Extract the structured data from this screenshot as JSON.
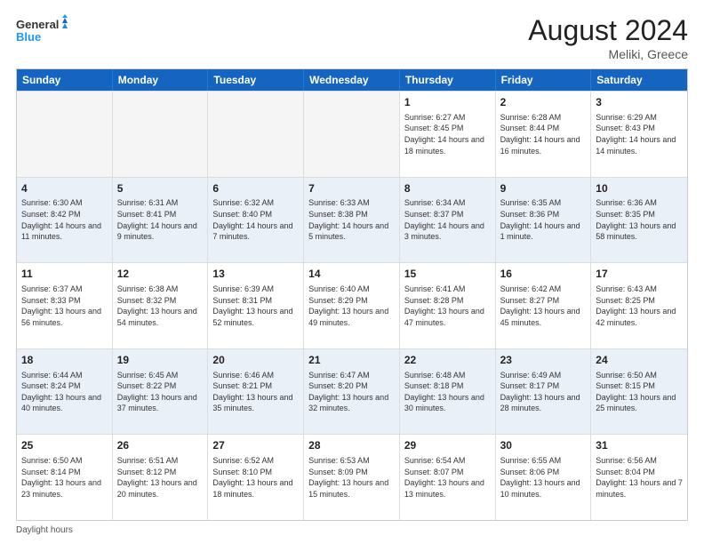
{
  "header": {
    "logo_line1": "General",
    "logo_line2": "Blue",
    "month_year": "August 2024",
    "location": "Meliki, Greece"
  },
  "day_headers": [
    "Sunday",
    "Monday",
    "Tuesday",
    "Wednesday",
    "Thursday",
    "Friday",
    "Saturday"
  ],
  "weeks": [
    [
      {
        "day": "",
        "sunrise": "",
        "sunset": "",
        "daylight": "",
        "empty": true
      },
      {
        "day": "",
        "sunrise": "",
        "sunset": "",
        "daylight": "",
        "empty": true
      },
      {
        "day": "",
        "sunrise": "",
        "sunset": "",
        "daylight": "",
        "empty": true
      },
      {
        "day": "",
        "sunrise": "",
        "sunset": "",
        "daylight": "",
        "empty": true
      },
      {
        "day": "1",
        "sunrise": "Sunrise: 6:27 AM",
        "sunset": "Sunset: 8:45 PM",
        "daylight": "Daylight: 14 hours and 18 minutes."
      },
      {
        "day": "2",
        "sunrise": "Sunrise: 6:28 AM",
        "sunset": "Sunset: 8:44 PM",
        "daylight": "Daylight: 14 hours and 16 minutes."
      },
      {
        "day": "3",
        "sunrise": "Sunrise: 6:29 AM",
        "sunset": "Sunset: 8:43 PM",
        "daylight": "Daylight: 14 hours and 14 minutes."
      }
    ],
    [
      {
        "day": "4",
        "sunrise": "Sunrise: 6:30 AM",
        "sunset": "Sunset: 8:42 PM",
        "daylight": "Daylight: 14 hours and 11 minutes."
      },
      {
        "day": "5",
        "sunrise": "Sunrise: 6:31 AM",
        "sunset": "Sunset: 8:41 PM",
        "daylight": "Daylight: 14 hours and 9 minutes."
      },
      {
        "day": "6",
        "sunrise": "Sunrise: 6:32 AM",
        "sunset": "Sunset: 8:40 PM",
        "daylight": "Daylight: 14 hours and 7 minutes."
      },
      {
        "day": "7",
        "sunrise": "Sunrise: 6:33 AM",
        "sunset": "Sunset: 8:38 PM",
        "daylight": "Daylight: 14 hours and 5 minutes."
      },
      {
        "day": "8",
        "sunrise": "Sunrise: 6:34 AM",
        "sunset": "Sunset: 8:37 PM",
        "daylight": "Daylight: 14 hours and 3 minutes."
      },
      {
        "day": "9",
        "sunrise": "Sunrise: 6:35 AM",
        "sunset": "Sunset: 8:36 PM",
        "daylight": "Daylight: 14 hours and 1 minute."
      },
      {
        "day": "10",
        "sunrise": "Sunrise: 6:36 AM",
        "sunset": "Sunset: 8:35 PM",
        "daylight": "Daylight: 13 hours and 58 minutes."
      }
    ],
    [
      {
        "day": "11",
        "sunrise": "Sunrise: 6:37 AM",
        "sunset": "Sunset: 8:33 PM",
        "daylight": "Daylight: 13 hours and 56 minutes."
      },
      {
        "day": "12",
        "sunrise": "Sunrise: 6:38 AM",
        "sunset": "Sunset: 8:32 PM",
        "daylight": "Daylight: 13 hours and 54 minutes."
      },
      {
        "day": "13",
        "sunrise": "Sunrise: 6:39 AM",
        "sunset": "Sunset: 8:31 PM",
        "daylight": "Daylight: 13 hours and 52 minutes."
      },
      {
        "day": "14",
        "sunrise": "Sunrise: 6:40 AM",
        "sunset": "Sunset: 8:29 PM",
        "daylight": "Daylight: 13 hours and 49 minutes."
      },
      {
        "day": "15",
        "sunrise": "Sunrise: 6:41 AM",
        "sunset": "Sunset: 8:28 PM",
        "daylight": "Daylight: 13 hours and 47 minutes."
      },
      {
        "day": "16",
        "sunrise": "Sunrise: 6:42 AM",
        "sunset": "Sunset: 8:27 PM",
        "daylight": "Daylight: 13 hours and 45 minutes."
      },
      {
        "day": "17",
        "sunrise": "Sunrise: 6:43 AM",
        "sunset": "Sunset: 8:25 PM",
        "daylight": "Daylight: 13 hours and 42 minutes."
      }
    ],
    [
      {
        "day": "18",
        "sunrise": "Sunrise: 6:44 AM",
        "sunset": "Sunset: 8:24 PM",
        "daylight": "Daylight: 13 hours and 40 minutes."
      },
      {
        "day": "19",
        "sunrise": "Sunrise: 6:45 AM",
        "sunset": "Sunset: 8:22 PM",
        "daylight": "Daylight: 13 hours and 37 minutes."
      },
      {
        "day": "20",
        "sunrise": "Sunrise: 6:46 AM",
        "sunset": "Sunset: 8:21 PM",
        "daylight": "Daylight: 13 hours and 35 minutes."
      },
      {
        "day": "21",
        "sunrise": "Sunrise: 6:47 AM",
        "sunset": "Sunset: 8:20 PM",
        "daylight": "Daylight: 13 hours and 32 minutes."
      },
      {
        "day": "22",
        "sunrise": "Sunrise: 6:48 AM",
        "sunset": "Sunset: 8:18 PM",
        "daylight": "Daylight: 13 hours and 30 minutes."
      },
      {
        "day": "23",
        "sunrise": "Sunrise: 6:49 AM",
        "sunset": "Sunset: 8:17 PM",
        "daylight": "Daylight: 13 hours and 28 minutes."
      },
      {
        "day": "24",
        "sunrise": "Sunrise: 6:50 AM",
        "sunset": "Sunset: 8:15 PM",
        "daylight": "Daylight: 13 hours and 25 minutes."
      }
    ],
    [
      {
        "day": "25",
        "sunrise": "Sunrise: 6:50 AM",
        "sunset": "Sunset: 8:14 PM",
        "daylight": "Daylight: 13 hours and 23 minutes."
      },
      {
        "day": "26",
        "sunrise": "Sunrise: 6:51 AM",
        "sunset": "Sunset: 8:12 PM",
        "daylight": "Daylight: 13 hours and 20 minutes."
      },
      {
        "day": "27",
        "sunrise": "Sunrise: 6:52 AM",
        "sunset": "Sunset: 8:10 PM",
        "daylight": "Daylight: 13 hours and 18 minutes."
      },
      {
        "day": "28",
        "sunrise": "Sunrise: 6:53 AM",
        "sunset": "Sunset: 8:09 PM",
        "daylight": "Daylight: 13 hours and 15 minutes."
      },
      {
        "day": "29",
        "sunrise": "Sunrise: 6:54 AM",
        "sunset": "Sunset: 8:07 PM",
        "daylight": "Daylight: 13 hours and 13 minutes."
      },
      {
        "day": "30",
        "sunrise": "Sunrise: 6:55 AM",
        "sunset": "Sunset: 8:06 PM",
        "daylight": "Daylight: 13 hours and 10 minutes."
      },
      {
        "day": "31",
        "sunrise": "Sunrise: 6:56 AM",
        "sunset": "Sunset: 8:04 PM",
        "daylight": "Daylight: 13 hours and 7 minutes."
      }
    ]
  ],
  "footer": {
    "note": "Daylight hours"
  }
}
